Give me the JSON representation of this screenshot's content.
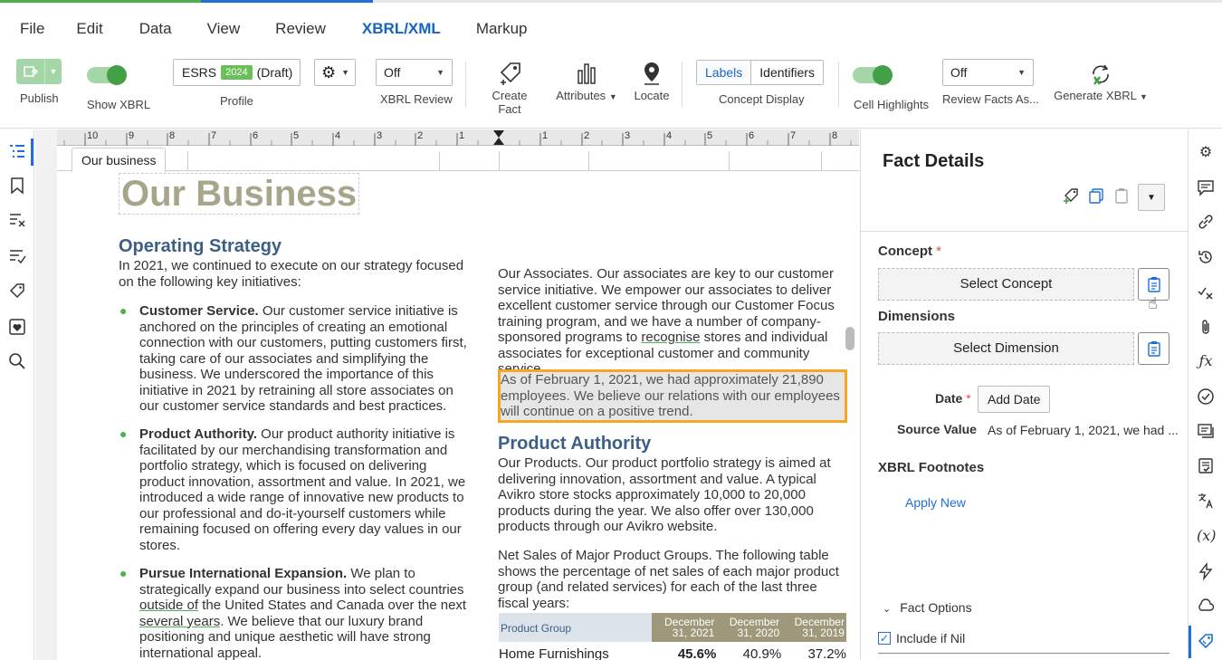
{
  "menu": [
    "File",
    "Edit",
    "Data",
    "View",
    "Review",
    "XBRL/XML",
    "Markup"
  ],
  "toolbar": {
    "publish": "Publish",
    "show_xbrl": "Show XBRL",
    "profile_label": "Profile",
    "profile_name": "ESRS",
    "profile_year": "2024",
    "profile_state": "(Draft)",
    "xbrl_review_value": "Off",
    "xbrl_review_label": "XBRL Review",
    "create_fact": "Create Fact",
    "attributes": "Attributes",
    "locate": "Locate",
    "labels_btn": "Labels",
    "identifiers_btn": "Identifiers",
    "concept_display": "Concept Display",
    "cell_highlights": "Cell Highlights",
    "review_facts_value": "Off",
    "review_facts_label": "Review Facts As...",
    "generate_xbrl": "Generate XBRL"
  },
  "document": {
    "tab": "Our business",
    "title": "Our Business",
    "left": {
      "heading": "Operating Strategy",
      "intro": "In 2021, we continued to execute on our strategy focused on the following key initiatives:",
      "b1_bold": "Customer Service.",
      "b1_text": " Our customer service initiative is anchored on the principles of creating an emotional connection with our customers, putting customers first, taking care of our associates and simplifying the business. We underscored the importance of this initiative in 2021 by retraining all store associates on our customer service standards and best practices.",
      "b2_bold": "Product Authority.",
      "b2_text": " Our product authority initiative is facilitated by our merchandising transformation and portfolio strategy, which is focused on delivering product innovation, assortment and value. In 2021, we introduced a wide range of innovative new products to our professional and do-it-yourself customers while remaining focused on offering every day values in our stores.",
      "b3_bold": "Pursue International Expansion.",
      "b3_text1": " We plan to strategically expand our business into select countries ",
      "b3_u1": "outside of",
      "b3_text2": " the United States and Canada over the next ",
      "b3_u2": "several years",
      "b3_text3": ". We believe that our luxury brand positioning and unique aesthetic will have strong international appeal."
    },
    "right": {
      "assoc1": "Our Associates. Our associates are key to our customer service initiative. We empower our associates to deliver excellent customer service through our Customer Focus training program, and we have a number of company-sponsored programs to ",
      "assoc_u": "recognise",
      "assoc2": " stores and individual associates for exceptional customer and community service.",
      "highlight": "As of February 1, 2021, we had approximately 21,890 employees. We believe our relations with our employees will continue on a positive trend.",
      "heading": "Product Authority",
      "products": "Our Products. Our product portfolio strategy is aimed at delivering innovation, assortment and value. A typical Avikro store stocks approximately 10,000 to 20,000 products during the year. We also offer over 130,000 products through our Avikro website.",
      "netsales": "Net Sales of Major Product Groups. The following table shows the percentage of net sales of each major product group (and related services) for each of the last three fiscal years:"
    },
    "table": {
      "header": [
        "Product Group",
        "December 31, 2021",
        "December 31, 2020",
        "December 31, 2019"
      ],
      "row": [
        "Home Furnishings",
        "45.6%",
        "40.9%",
        "37.2%"
      ]
    },
    "ruler": [
      "10",
      "9",
      "8",
      "7",
      "6",
      "5",
      "4",
      "3",
      "2",
      "1",
      "1",
      "2",
      "3",
      "4",
      "5",
      "6",
      "7",
      "8"
    ]
  },
  "panel": {
    "title": "Fact Details",
    "concept": "Concept",
    "select_concept": "Select Concept",
    "dimensions": "Dimensions",
    "select_dimension": "Select Dimension",
    "date": "Date",
    "add_date": "Add Date",
    "source_value_label": "Source Value",
    "source_value": "As of February 1, 2021, we had ...",
    "footnotes": "XBRL Footnotes",
    "apply_new": "Apply New",
    "fact_options": "Fact Options",
    "include_nil": "Include if Nil"
  },
  "colors": {
    "accent": "#1e6fd9",
    "green": "#43a047",
    "highlight": "#f5a623",
    "heading": "#3d5f87"
  }
}
